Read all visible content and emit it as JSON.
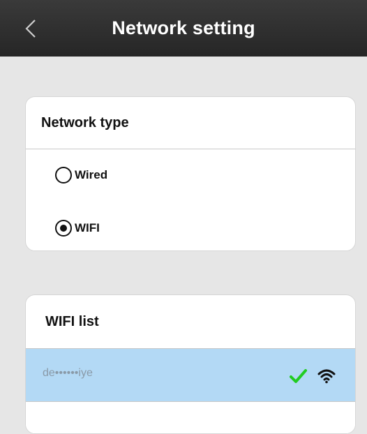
{
  "header": {
    "title": "Network setting"
  },
  "network_type": {
    "title": "Network type",
    "options": [
      {
        "label": "Wired",
        "selected": false
      },
      {
        "label": "WIFI",
        "selected": true
      }
    ]
  },
  "wifi_list": {
    "title": "WIFI list",
    "networks": [
      {
        "ssid": "de••••••iye",
        "connected": true,
        "icon": "wifi-signal-icon"
      }
    ]
  },
  "colors": {
    "header_bg": "#2e2e2e",
    "selected_row": "#b3d9f5",
    "check": "#22cc22"
  }
}
